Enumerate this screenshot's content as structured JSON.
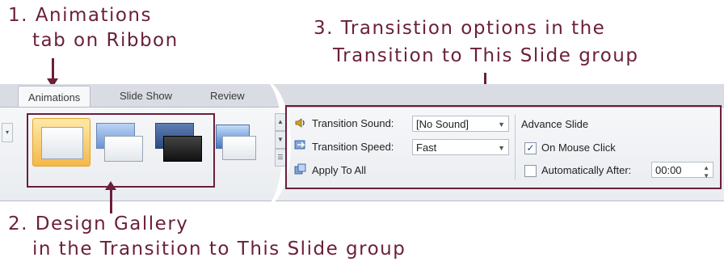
{
  "callouts": {
    "one_line1": "1. Animations",
    "one_line2": "tab on Ribbon",
    "two_line1": "2. Design Gallery",
    "two_line2": "in the Transition to This Slide group",
    "three_line1": "3. Transistion options in the",
    "three_line2": "Transition to This Slide group"
  },
  "tabs": [
    {
      "label": "Animations",
      "active": true
    },
    {
      "label": "Slide Show",
      "active": false
    },
    {
      "label": "Review",
      "active": false
    }
  ],
  "transition": {
    "sound_label": "Transition Sound:",
    "sound_value": "[No Sound]",
    "speed_label": "Transition Speed:",
    "speed_value": "Fast",
    "apply_all": "Apply To All"
  },
  "advance": {
    "title": "Advance Slide",
    "on_click_label": "On Mouse Click",
    "on_click_checked": true,
    "auto_after_label": "Automatically After:",
    "auto_after_checked": false,
    "auto_after_value": "00:00"
  },
  "colors": {
    "annotation": "#6b1f3a",
    "selected_thumb": "#f4b84a",
    "ribbon_bg": "#eef0f3"
  },
  "icons": [
    "sound-icon",
    "speed-icon",
    "apply-all-icon",
    "checkmark-icon",
    "spin-up-icon",
    "spin-down-icon",
    "dropdown-caret-icon"
  ]
}
